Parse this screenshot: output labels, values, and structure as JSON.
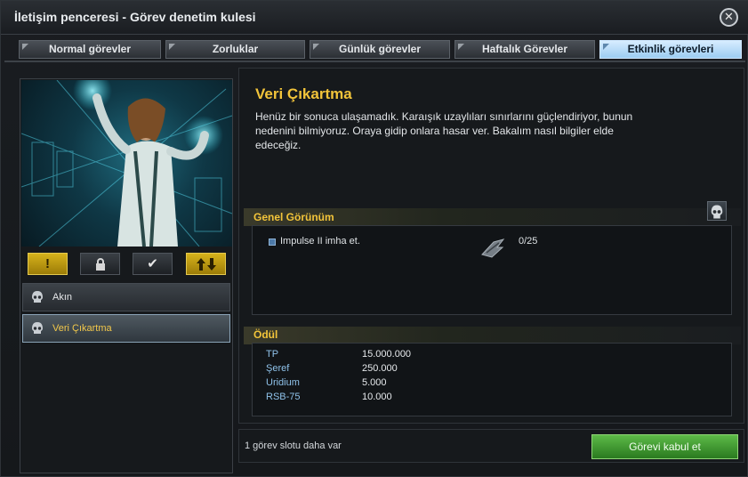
{
  "window": {
    "title": "İletişim penceresi - Görev denetim kulesi"
  },
  "tabs": [
    {
      "label": "Normal görevler"
    },
    {
      "label": "Zorluklar"
    },
    {
      "label": "Günlük görevler"
    },
    {
      "label": "Haftalık Görevler"
    },
    {
      "label": "Etkinlik görevleri",
      "active": true
    }
  ],
  "left_panel": {
    "icon_buttons": [
      {
        "name": "exclamation",
        "glyph": "!"
      },
      {
        "name": "lock",
        "glyph": "🔒"
      },
      {
        "name": "check",
        "glyph": "✔"
      },
      {
        "name": "up-down-arrows",
        "glyph": "⇅"
      }
    ],
    "missions": [
      {
        "label": "Akın",
        "selected": false
      },
      {
        "label": "Veri Çıkartma",
        "selected": true
      }
    ]
  },
  "mission": {
    "title": "Veri Çıkartma",
    "description": "Henüz bir sonuca ulaşamadık. Karaışık uzaylıları sınırlarını güçlendiriyor, bunun nedenini bilmiyoruz. Oraya gidip onlara hasar ver. Bakalım nasıl bilgiler elde edeceğiz."
  },
  "overview": {
    "heading": "Genel Görünüm",
    "tasks": [
      {
        "label": "Impulse II imha et.",
        "progress": "0/25"
      }
    ]
  },
  "rewards": {
    "heading": "Ödül",
    "items": [
      {
        "name": "TP",
        "value": "15.000.000"
      },
      {
        "name": "Şeref",
        "value": "250.000"
      },
      {
        "name": "Uridium",
        "value": "5.000"
      },
      {
        "name": "RSB-75",
        "value": "10.000"
      }
    ]
  },
  "footer": {
    "slot_text": "1 görev slotu daha var",
    "accept_label": "Görevi kabul et"
  },
  "colors": {
    "accent": "#f2c43a",
    "reward_name": "#8fc2ea",
    "active_tab": "#9ccdf2",
    "accept": "#2a7a1f"
  }
}
